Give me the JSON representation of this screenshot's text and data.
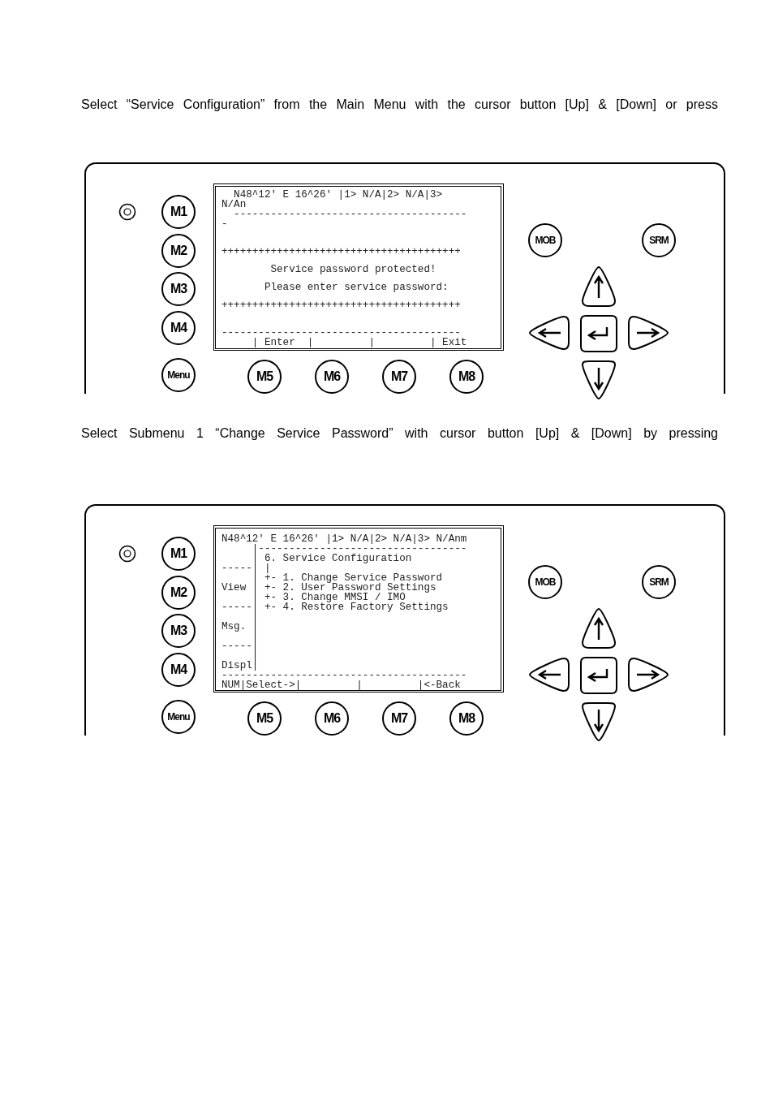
{
  "sections": [
    {
      "paragraph": "Select “Service Configuration” from the Main Menu with the cursor button [Up] & [Down] or press",
      "device": {
        "left_keys": [
          "M1",
          "M2",
          "M3",
          "M4"
        ],
        "menu_key": "Menu",
        "bottom_keys": [
          "M5",
          "M6",
          "M7",
          "M8"
        ],
        "top_right_keys": [
          "MOB",
          "SRM"
        ],
        "screen": {
          "kind": "dialog",
          "header": [
            "  N48^12' E 16^26' |1> N/A|2> N/A|3>",
            "N/An",
            "  --------------------------------------",
            "-"
          ],
          "body": [
            "+++++++++++++++++++++++++++++++++++++++",
            "        Service password protected!",
            "       Please enter service password:",
            "+++++++++++++++++++++++++++++++++++++++"
          ],
          "footer": [
            "---------------------------------------",
            "     | Enter  |         |         | Exit"
          ]
        }
      }
    },
    {
      "paragraph": "Select Submenu 1 “Change Service Password” with cursor button [Up] & [Down] by pressing",
      "device": {
        "left_keys": [
          "M1",
          "M2",
          "M3",
          "M4"
        ],
        "menu_key": "Menu",
        "bottom_keys": [
          "M5",
          "M6",
          "M7",
          "M8"
        ],
        "top_right_keys": [
          "MOB",
          "SRM"
        ],
        "screen": {
          "kind": "menu",
          "lines": [
            "N48^12' E 16^26' |1> N/A|2> N/A|3> N/Anm",
            "     |----------------------------------",
            "     | 6. Service Configuration",
            "-----| |",
            "     | +- 1. Change Service Password",
            "View | +- 2. User Password Settings",
            "     | +- 3. Change MMSI / IMO",
            "-----| +- 4. Restore Factory Settings",
            "     |",
            "Msg. |",
            "     |",
            "-----|",
            "     |",
            "Displ|",
            "----------------------------------------",
            "NUM|Select->|         |         |<-Back"
          ]
        }
      }
    }
  ]
}
